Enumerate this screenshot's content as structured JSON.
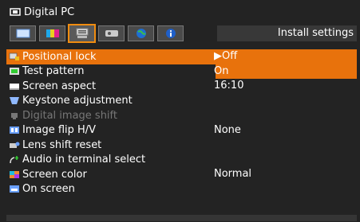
{
  "title": "Digital PC",
  "tab_title": "Install settings",
  "tabs": [
    {
      "icon": "picture-icon",
      "active": false
    },
    {
      "icon": "color-bars-icon",
      "active": false
    },
    {
      "icon": "install-settings-icon",
      "active": true
    },
    {
      "icon": "system-icon",
      "active": false
    },
    {
      "icon": "network-globe-icon",
      "active": false
    },
    {
      "icon": "info-icon",
      "active": false
    }
  ],
  "menu": [
    {
      "label": "Positional lock",
      "value": "▶Off",
      "icon": "lock-icon",
      "selected": true,
      "disabled": false
    },
    {
      "label": "Test pattern",
      "value": "On",
      "icon": "test-pattern-icon",
      "selected": false,
      "disabled": false
    },
    {
      "label": "Screen aspect",
      "value": "16:10",
      "icon": "screen-aspect-icon",
      "selected": false,
      "disabled": false
    },
    {
      "label": "Keystone adjustment",
      "value": "",
      "icon": "keystone-icon",
      "selected": false,
      "disabled": false
    },
    {
      "label": "Digital image shift",
      "value": "",
      "icon": "image-shift-icon",
      "selected": false,
      "disabled": true
    },
    {
      "label": "Image flip H/V",
      "value": "None",
      "icon": "image-flip-icon",
      "selected": false,
      "disabled": false
    },
    {
      "label": "Lens shift reset",
      "value": "",
      "icon": "lens-shift-icon",
      "selected": false,
      "disabled": false
    },
    {
      "label": "Audio in terminal select",
      "value": "",
      "icon": "audio-icon",
      "selected": false,
      "disabled": false
    },
    {
      "label": "Screen color",
      "value": "Normal",
      "icon": "screen-color-icon",
      "selected": false,
      "disabled": false
    },
    {
      "label": "On screen",
      "value": "",
      "icon": "on-screen-icon",
      "selected": false,
      "disabled": false
    }
  ]
}
